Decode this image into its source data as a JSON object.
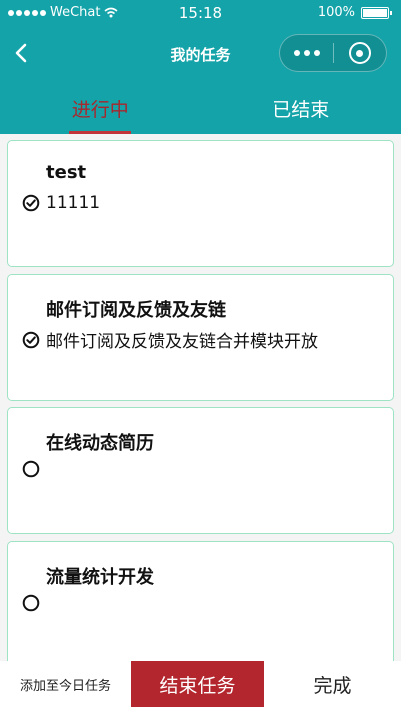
{
  "status_bar": {
    "carrier": "WeChat",
    "time": "15:18",
    "battery": "100%"
  },
  "nav": {
    "title": "我的任务"
  },
  "tabs": [
    {
      "label": "进行中",
      "active": true
    },
    {
      "label": "已结束",
      "active": false
    }
  ],
  "tasks": [
    {
      "title": "test",
      "description": "11111",
      "status_icon": "check-circle-icon"
    },
    {
      "title": "邮件订阅及反馈及友链",
      "description": "邮件订阅及反馈及友链合并模块开放",
      "status_icon": "check-circle-icon"
    },
    {
      "title": "在线动态简历",
      "description": "",
      "status_icon": "empty-circle-icon"
    },
    {
      "title": "流量统计开发",
      "description": "",
      "status_icon": "empty-circle-icon"
    }
  ],
  "bottom_bar": {
    "add_today_label": "添加至今日任务",
    "end_task_label": "结束任务",
    "done_label": "完成"
  },
  "colors": {
    "header": "#14a3a8",
    "accent": "#b3262d",
    "card_border": "#9ee3c4"
  }
}
